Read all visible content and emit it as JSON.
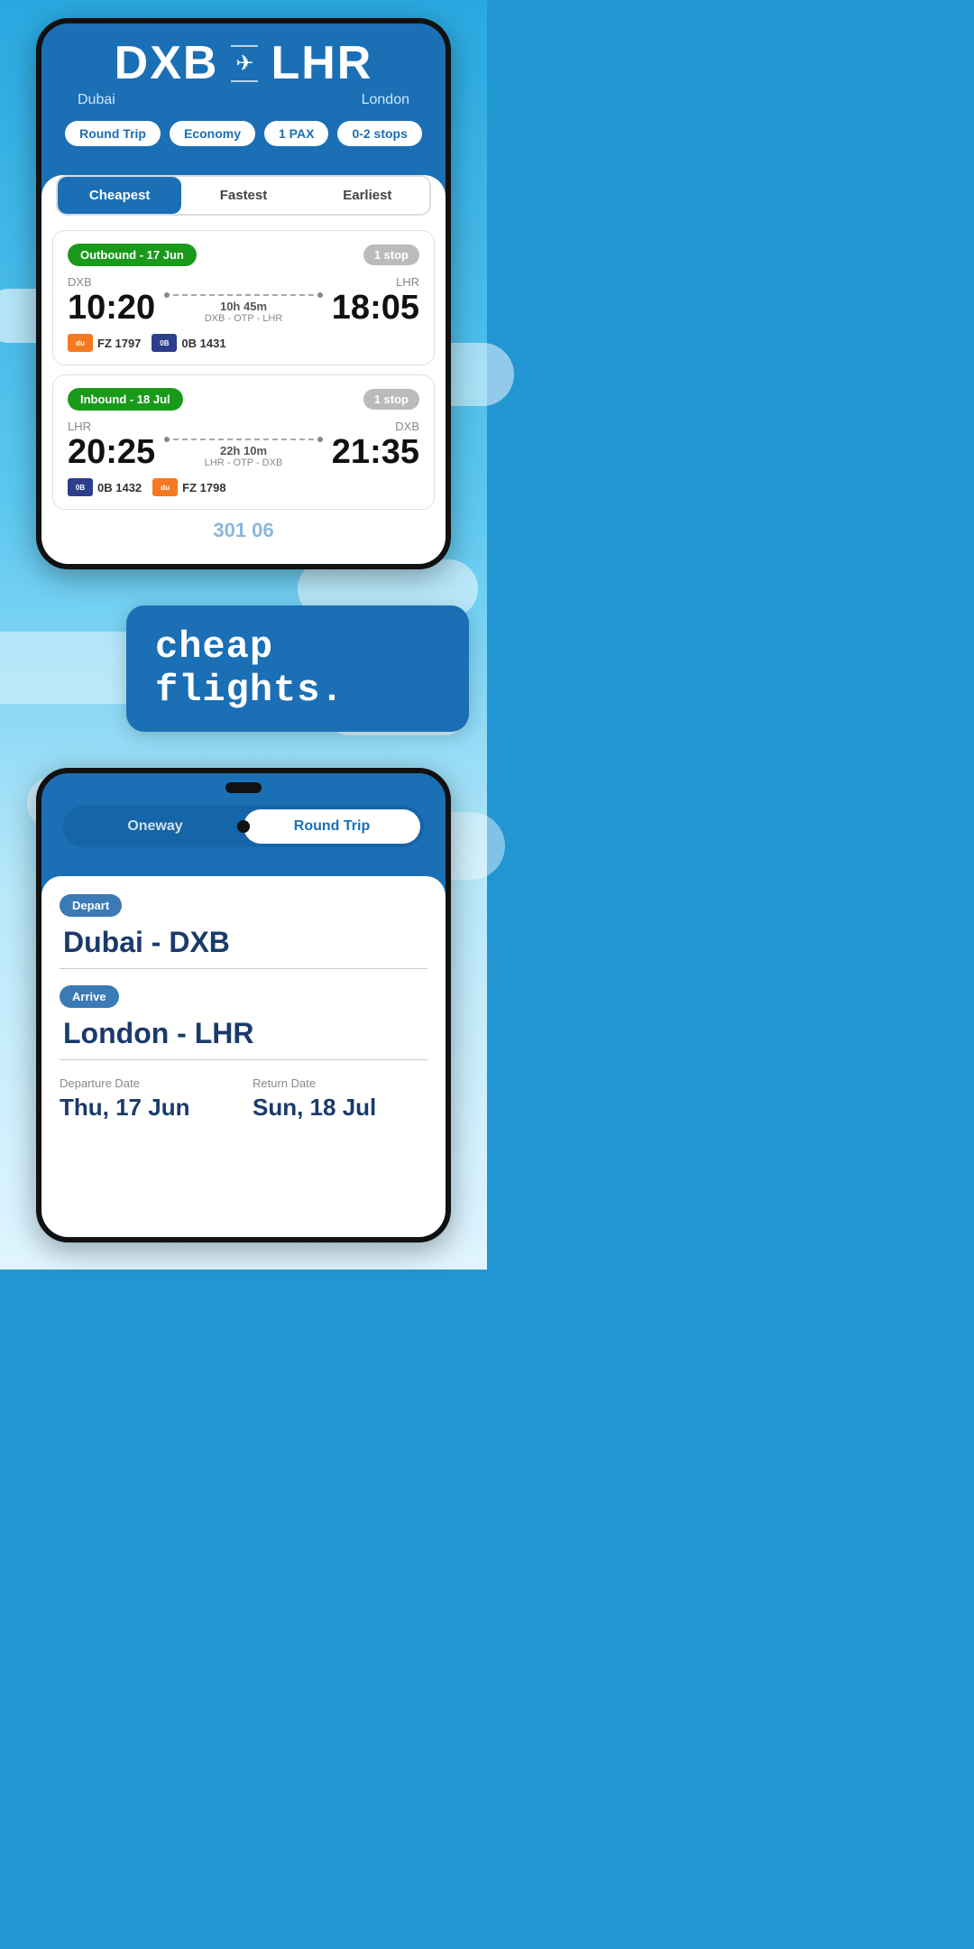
{
  "phone1": {
    "origin": {
      "code": "DXB",
      "city": "Dubai"
    },
    "destination": {
      "code": "LHR",
      "city": "London"
    },
    "tags": {
      "trip_type": "Round Trip",
      "cabin": "Economy",
      "pax": "1 PAX",
      "stops": "0-2 stops"
    },
    "sort_tabs": {
      "cheapest": "Cheapest",
      "fastest": "Fastest",
      "earliest": "Earliest",
      "active": "cheapest"
    },
    "outbound": {
      "label": "Outbound - 17 Jun",
      "stop_count": "1 stop",
      "origin_code": "DXB",
      "dest_code": "LHR",
      "depart_time": "10:20",
      "arrive_time": "18:05",
      "duration": "10h 45m",
      "route": "DXB - OTP - LHR",
      "airlines": [
        {
          "code": "FZ 1797",
          "color": "orange",
          "label": "dubai"
        },
        {
          "code": "0B 1431",
          "color": "blue",
          "label": "0B"
        }
      ]
    },
    "inbound": {
      "label": "Inbound - 18 Jul",
      "stop_count": "1 stop",
      "origin_code": "LHR",
      "dest_code": "DXB",
      "depart_time": "20:25",
      "arrive_time": "21:35",
      "duration": "22h 10m",
      "route": "LHR - OTP - DXB",
      "airlines": [
        {
          "code": "0B 1432",
          "color": "blue",
          "label": "0B"
        },
        {
          "code": "FZ 1798",
          "color": "orange",
          "label": "dubai"
        }
      ]
    },
    "price_partial": "301 06"
  },
  "promo": {
    "text": "cheap flights."
  },
  "phone2": {
    "toggle": {
      "oneway": "Oneway",
      "round_trip": "Round Trip"
    },
    "depart_label": "Depart",
    "depart_value": "Dubai - DXB",
    "arrive_label": "Arrive",
    "arrive_value": "London - LHR",
    "departure_date_label": "Departure Date",
    "departure_date_value": "Thu, 17 Jun",
    "return_date_label": "Return Date",
    "return_date_value": "Sun, 18 Jul"
  }
}
